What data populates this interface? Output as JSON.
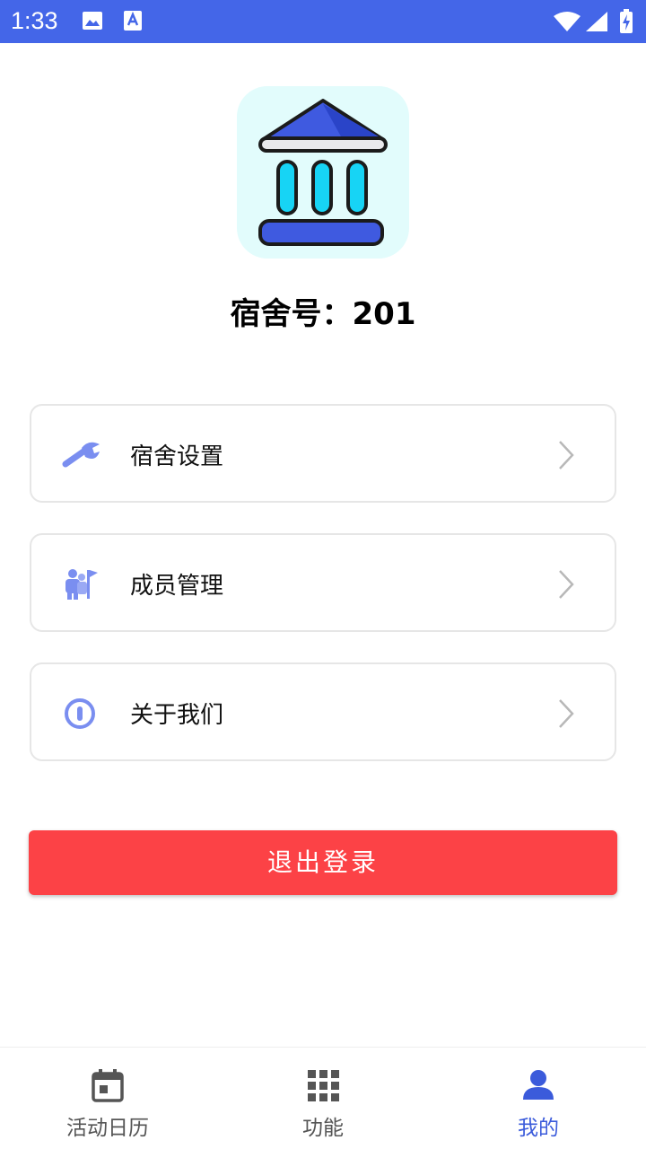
{
  "status_bar": {
    "time": "1:33",
    "background": "#4466e8",
    "icons": [
      "image-icon",
      "font-a-icon",
      "wifi-icon",
      "cellular-signal-icon",
      "battery-charging-icon"
    ]
  },
  "profile": {
    "logo_icon": "dormitory-building-icon",
    "dorm_title": "宿舍号：201"
  },
  "menu": [
    {
      "label": "宿舍设置",
      "icon": "wrench-icon"
    },
    {
      "label": "成员管理",
      "icon": "members-flag-icon"
    },
    {
      "label": "关于我们",
      "icon": "info-circle-icon"
    }
  ],
  "logout": {
    "label": "退出登录",
    "color": "#fc4246"
  },
  "bottom_nav": {
    "items": [
      {
        "label": "活动日历",
        "icon": "calendar-icon",
        "active": false
      },
      {
        "label": "功能",
        "icon": "grid-icon",
        "active": false
      },
      {
        "label": "我的",
        "icon": "person-icon",
        "active": true
      }
    ],
    "active_color": "#3b5bdb",
    "inactive_color": "#555555"
  },
  "theme": {
    "accent": "#4466e8",
    "logo_background": "#e2fcfc"
  }
}
